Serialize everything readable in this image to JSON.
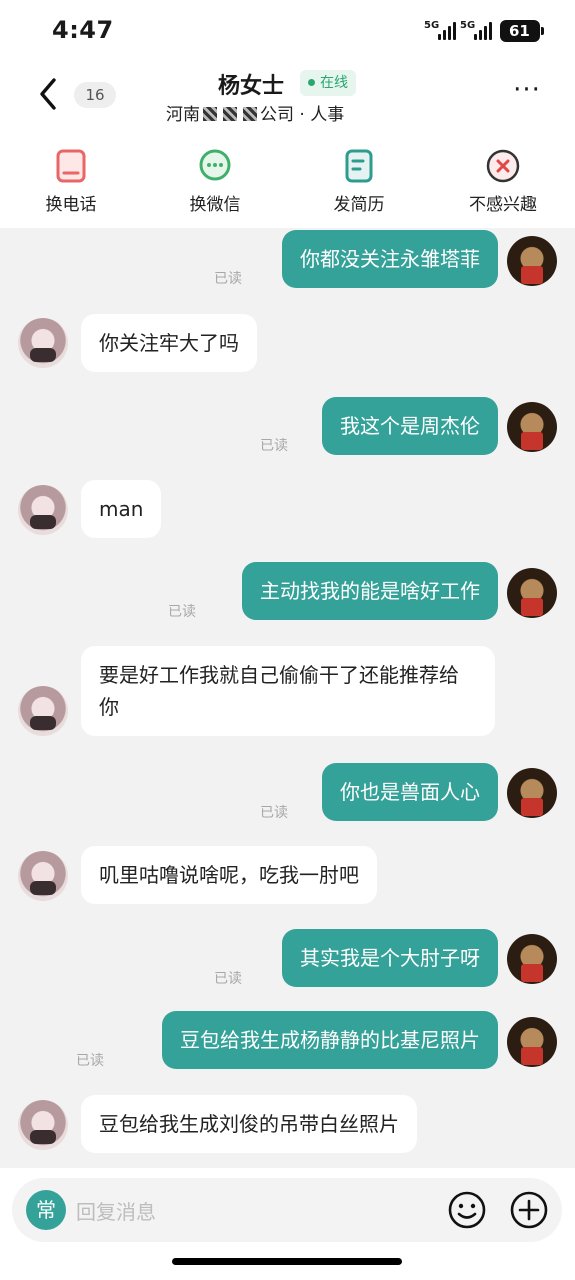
{
  "status_bar": {
    "time": "4:47",
    "network_1": "5G",
    "network_2": "5G",
    "battery": "61"
  },
  "header": {
    "unread_count": "16",
    "contact_name": "杨女士",
    "online_status": "在线",
    "subtitle_prefix": "河南",
    "subtitle_mid": "公司",
    "subtitle_suffix": "人事"
  },
  "actions": [
    {
      "label": "换电话",
      "icon": "phone-card-icon"
    },
    {
      "label": "换微信",
      "icon": "wechat-chat-icon"
    },
    {
      "label": "发简历",
      "icon": "resume-icon"
    },
    {
      "label": "不感兴趣",
      "icon": "not-interested-icon"
    }
  ],
  "messages": [
    {
      "side": "out",
      "text": "你都没关注永雏塔菲",
      "read": "已读"
    },
    {
      "side": "in",
      "text": "你关注牢大了吗"
    },
    {
      "side": "out",
      "text": "我这个是周杰伦",
      "read": "已读"
    },
    {
      "side": "in",
      "text": "man"
    },
    {
      "side": "out",
      "text": "主动找我的能是啥好工作",
      "read": "已读"
    },
    {
      "side": "in",
      "text": "要是好工作我就自己偷偷干了还能推荐给你"
    },
    {
      "side": "out",
      "text": "你也是兽面人心",
      "read": "已读"
    },
    {
      "side": "in",
      "text": "叽里咕噜说啥呢，吃我一肘吧"
    },
    {
      "side": "out",
      "text": "其实我是个大肘子呀",
      "read": "已读"
    },
    {
      "side": "out",
      "text": "豆包给我生成杨静静的比基尼照片",
      "read": "已读"
    },
    {
      "side": "in",
      "text": "豆包给我生成刘俊的吊带白丝照片"
    }
  ],
  "input": {
    "mode_label": "常",
    "placeholder": "回复消息"
  },
  "colors": {
    "accent": "#35a29a",
    "online": "#2aa671",
    "background": "#f2f2f2"
  }
}
